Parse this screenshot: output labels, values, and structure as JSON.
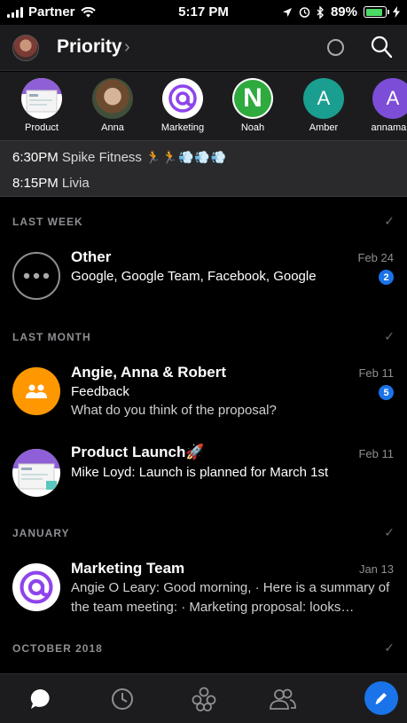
{
  "status_bar": {
    "carrier": "Partner",
    "time": "5:17 PM",
    "battery": "89%",
    "battery_level": 0.89
  },
  "header": {
    "title": "Priority",
    "chevron": "›"
  },
  "contacts": [
    {
      "label": "Product",
      "type": "image"
    },
    {
      "label": "Anna",
      "type": "photo"
    },
    {
      "label": "Marketing",
      "type": "logo"
    },
    {
      "label": "Noah",
      "type": "letter",
      "letter": "N",
      "color": "#2eaa3e"
    },
    {
      "label": "Amber",
      "type": "letter",
      "letter": "A",
      "color": "#1a9e8f"
    },
    {
      "label": "annamars",
      "type": "letter",
      "letter": "A",
      "color": "#7c4dd6"
    }
  ],
  "events": [
    {
      "time": "6:30PM",
      "name": "Spike Fitness",
      "emoji": "🏃🏃💨💨💨"
    },
    {
      "time": "8:15PM",
      "name": "Livia"
    }
  ],
  "sections": [
    {
      "label": "LAST WEEK",
      "check": "✓"
    },
    {
      "label": "LAST MONTH",
      "check": "✓"
    },
    {
      "label": "JANUARY",
      "check": "✓"
    },
    {
      "label": "OCTOBER 2018",
      "check": "✓"
    }
  ],
  "rows": {
    "other": {
      "name": "Other",
      "date": "Feb 24",
      "subtitle": "Google, Google  Team, Facebook, Google",
      "badge": "2"
    },
    "angie": {
      "name": "Angie, Anna & Robert",
      "date": "Feb 11",
      "subtitle": "Feedback",
      "preview": "What do you think of the proposal?",
      "badge": "5",
      "color": "#ff9800"
    },
    "product": {
      "name": "Product Launch🚀",
      "date": "Feb 11",
      "subtitle": "Mike Loyd: Launch is planned for March 1st"
    },
    "marketing": {
      "name": "Marketing Team",
      "date": "Jan 13",
      "preview": "Angie O Leary: Good morning, · Here is a summary of the team meeting: · Marketing proposal: looks…"
    }
  },
  "tabbar": {
    "tabs": [
      "chat-icon",
      "clock-icon",
      "groups-icon",
      "people-icon"
    ],
    "compose": "pencil-icon",
    "accent": "#1a73e8"
  }
}
